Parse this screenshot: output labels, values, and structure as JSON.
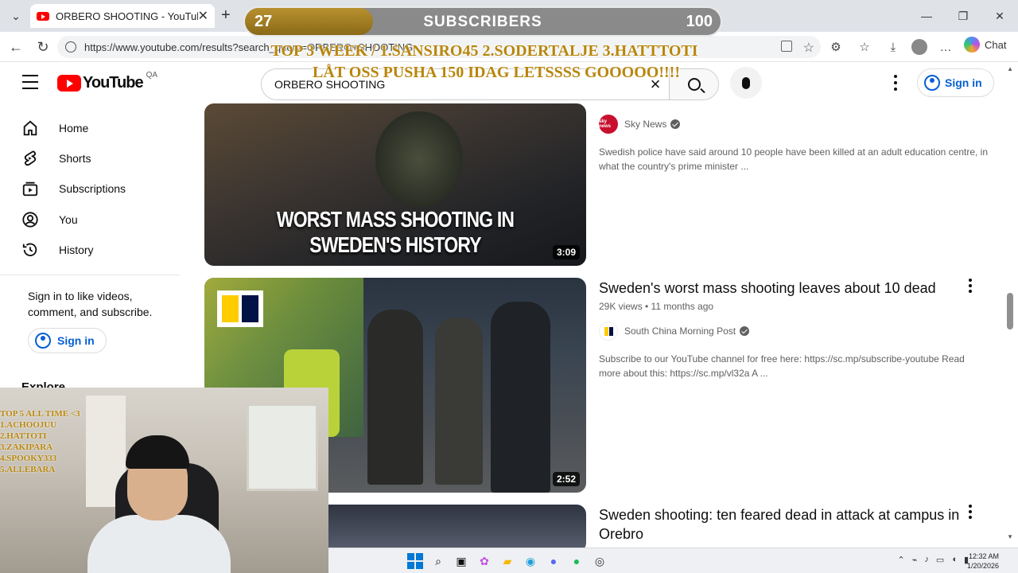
{
  "browser": {
    "tab_title": "ORBERO SHOOTING - YouTube",
    "url": "https://www.youtube.com/results?search_query=ORBERO+SHOOTING",
    "chat_label": "Chat"
  },
  "yt": {
    "logo_text": "YouTube",
    "country_code": "QA",
    "search_value": "ORBERO SHOOTING",
    "signin_label": "Sign in"
  },
  "sidebar": {
    "items": [
      {
        "label": "Home",
        "icon": "home-icon"
      },
      {
        "label": "Shorts",
        "icon": "shorts-icon"
      },
      {
        "label": "Subscriptions",
        "icon": "subscriptions-icon"
      },
      {
        "label": "You",
        "icon": "you-icon"
      },
      {
        "label": "History",
        "icon": "history-icon"
      }
    ],
    "signin_prompt": "Sign in to like videos, comment, and subscribe.",
    "signin_label": "Sign in",
    "explore_label": "Explore"
  },
  "results": [
    {
      "thumb_caption": "WORST MASS SHOOTING IN SWEDEN'S HISTORY",
      "duration": "3:09",
      "channel": "Sky News",
      "channel_avatar_text": "sky news",
      "description": "Swedish police have said around 10 people have been killed at an adult education centre, in what the country's prime minister ..."
    },
    {
      "title": "Sweden's worst mass shooting leaves about 10 dead",
      "meta": "29K views • 11 months ago",
      "duration": "2:52",
      "channel": "South China Morning Post",
      "description": "Subscribe to our YouTube channel for free here: https://sc.mp/subscribe-youtube Read more about this: https://sc.mp/vl32a A ..."
    },
    {
      "title": "Sweden shooting: ten feared dead in attack at campus in Orebro"
    }
  ],
  "overlay": {
    "sub_current": "27",
    "sub_label": "SUBSCRIBERS",
    "sub_goal": "100",
    "sub_progress": 0.27,
    "ticker_line1": "TOP 3 WEEK / 1.SANSIRO45 2.SODERTALJE 3.HATTTOTI",
    "ticker_line2": "LÅT OSS PUSHA 150 IDAG LETSSSS GOOOOO!!!!",
    "top5_title": "TOP 5 ALL TIME <3",
    "top5": [
      "1.ACHOOJUU",
      "2.HATTOTI",
      "3.ZAKIPARA",
      "4.SPOOKY333",
      "5.ALLEBARA"
    ]
  },
  "taskbar": {
    "time": "12:32 AM",
    "date": "1/20/2026"
  },
  "colors": {
    "yt_red": "#ff0000",
    "link_blue": "#065fd4",
    "overlay_gold": "#b8860b"
  }
}
